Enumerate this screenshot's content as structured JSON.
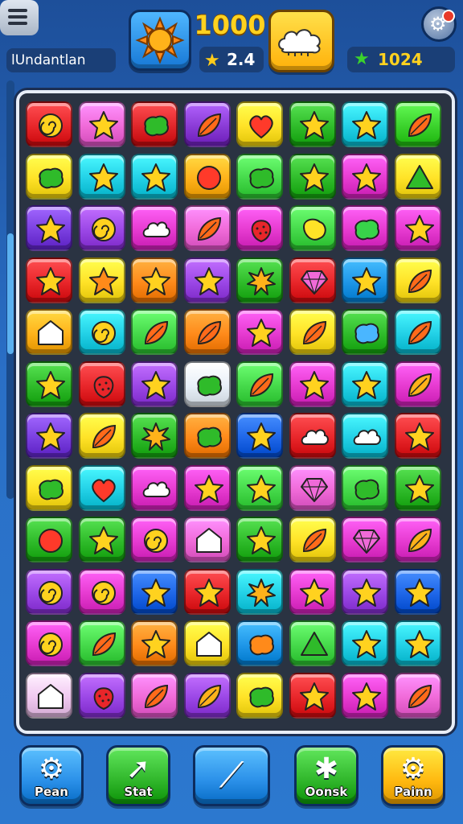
{
  "header": {
    "player_name": "lUndantlan",
    "score": "1000",
    "stars": "2.4",
    "gems": "1024",
    "icons": {
      "menu": "menu-icon",
      "sun": "sun-icon",
      "cloud": "cloud-icon",
      "settings": "gear-icon",
      "star": "star-icon",
      "gem": "gem-icon"
    }
  },
  "board": {
    "rows": [
      [
        [
          "#e8262a",
          "swirl"
        ],
        [
          "#f06ad8",
          "star"
        ],
        [
          "#e0262a",
          "blob"
        ],
        [
          "#8a3bd6",
          "leaf"
        ],
        [
          "#ffe227",
          "heart"
        ],
        [
          "#2fbb2a",
          "star"
        ],
        [
          "#22d0e6",
          "star"
        ],
        [
          "#3bd22c",
          "leaf"
        ]
      ],
      [
        [
          "#ffe227",
          "blob"
        ],
        [
          "#22d0e6",
          "star"
        ],
        [
          "#22d0e6",
          "star"
        ],
        [
          "#ffb21a",
          "circle"
        ],
        [
          "#45d94a",
          "blob"
        ],
        [
          "#2fbb2a",
          "star"
        ],
        [
          "#e63ad0",
          "star"
        ],
        [
          "#ffe227",
          "triangle"
        ]
      ],
      [
        [
          "#7a3fe0",
          "star"
        ],
        [
          "#9b47e6",
          "swirl"
        ],
        [
          "#e63ad0",
          "cloud"
        ],
        [
          "#f06ad8",
          "leaf"
        ],
        [
          "#e63ad0",
          "berry"
        ],
        [
          "#45d94a",
          "bean"
        ],
        [
          "#e63ad0",
          "blob"
        ],
        [
          "#e63ad0",
          "star"
        ]
      ],
      [
        [
          "#e8262a",
          "star"
        ],
        [
          "#ffe227",
          "star"
        ],
        [
          "#ff8a1a",
          "star"
        ],
        [
          "#9b47e6",
          "star"
        ],
        [
          "#2fbb2a",
          "burst"
        ],
        [
          "#e8262a",
          "gem"
        ],
        [
          "#1e96e8",
          "star"
        ],
        [
          "#ffe227",
          "leaf"
        ]
      ],
      [
        [
          "#ffb21a",
          "house"
        ],
        [
          "#22d0e6",
          "swirl"
        ],
        [
          "#45d94a",
          "leaf"
        ],
        [
          "#ff8a1a",
          "leaf"
        ],
        [
          "#e63ad0",
          "star"
        ],
        [
          "#ffe227",
          "leaf"
        ],
        [
          "#2fbb2a",
          "blob"
        ],
        [
          "#22d0e6",
          "leaf"
        ]
      ],
      [
        [
          "#2fbb2a",
          "star"
        ],
        [
          "#e8262a",
          "berry"
        ],
        [
          "#9b47e6",
          "star"
        ],
        [
          "#e8f0f8",
          "blob"
        ],
        [
          "#45d94a",
          "leaf"
        ],
        [
          "#e63ad0",
          "star"
        ],
        [
          "#22d0e6",
          "star"
        ],
        [
          "#e63ad0",
          "leaf"
        ]
      ],
      [
        [
          "#7a3fe0",
          "star"
        ],
        [
          "#ffe227",
          "leaf"
        ],
        [
          "#2fbb2a",
          "burst"
        ],
        [
          "#ff8a1a",
          "blob"
        ],
        [
          "#1e66e8",
          "star"
        ],
        [
          "#e8262a",
          "cloud"
        ],
        [
          "#22d0e6",
          "cloud"
        ],
        [
          "#e8262a",
          "star"
        ]
      ],
      [
        [
          "#ffe227",
          "blob"
        ],
        [
          "#22d0e6",
          "heart"
        ],
        [
          "#e63ad0",
          "cloud"
        ],
        [
          "#e63ad0",
          "star"
        ],
        [
          "#45d94a",
          "star"
        ],
        [
          "#f06ad8",
          "gem"
        ],
        [
          "#45d94a",
          "blob"
        ],
        [
          "#2fbb2a",
          "star"
        ]
      ],
      [
        [
          "#2fbb2a",
          "circle"
        ],
        [
          "#2fbb2a",
          "star"
        ],
        [
          "#e63ad0",
          "swirl"
        ],
        [
          "#f06ad8",
          "house"
        ],
        [
          "#2fbb2a",
          "star"
        ],
        [
          "#ffe227",
          "leaf"
        ],
        [
          "#e63ad0",
          "gem"
        ],
        [
          "#e63ad0",
          "leaf"
        ]
      ],
      [
        [
          "#9b47e6",
          "swirl"
        ],
        [
          "#e63ad0",
          "swirl"
        ],
        [
          "#1e66e8",
          "star"
        ],
        [
          "#e8262a",
          "star"
        ],
        [
          "#22d0e6",
          "burst"
        ],
        [
          "#e63ad0",
          "star"
        ],
        [
          "#9b47e6",
          "star"
        ],
        [
          "#1e66e8",
          "star"
        ]
      ],
      [
        [
          "#e63ad0",
          "swirl"
        ],
        [
          "#45d94a",
          "leaf"
        ],
        [
          "#ff8a1a",
          "star"
        ],
        [
          "#ffe227",
          "house"
        ],
        [
          "#1e96e8",
          "blob"
        ],
        [
          "#45d94a",
          "triangle"
        ],
        [
          "#22d0e6",
          "star"
        ],
        [
          "#22d0e6",
          "star"
        ]
      ],
      [
        [
          "#f0c8f0",
          "house"
        ],
        [
          "#9b47e6",
          "berry"
        ],
        [
          "#f06ad8",
          "leaf"
        ],
        [
          "#9b47e6",
          "leaf"
        ],
        [
          "#ffe227",
          "blob"
        ],
        [
          "#e8262a",
          "star"
        ],
        [
          "#e63ad0",
          "star"
        ],
        [
          "#f06ad8",
          "leaf"
        ]
      ]
    ]
  },
  "buttons": [
    {
      "label": "Pean",
      "icon": "gear-icon",
      "glyph": "⚙",
      "color": "#2a8fe8"
    },
    {
      "label": "Stat",
      "icon": "arrow-up-icon",
      "glyph": "➚",
      "color": "#2fb52a"
    },
    {
      "label": "",
      "icon": "wand-icon",
      "glyph": "⟋",
      "color": "#2a8fe8"
    },
    {
      "label": "Oonsk",
      "icon": "puzzle-icon",
      "glyph": "✱",
      "color": "#2fb52a"
    },
    {
      "label": "Painn",
      "icon": "gear-icon",
      "glyph": "⚙",
      "color": "#ffb80f"
    }
  ]
}
